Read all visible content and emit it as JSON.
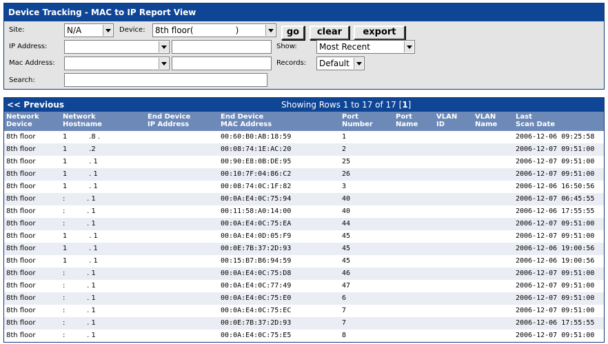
{
  "title": "Device Tracking - MAC to IP Report View",
  "filters": {
    "site_label": "Site:",
    "site_value": "N/A",
    "device_label": "Device:",
    "device_value": "8th floor(                )",
    "ip_label": "IP Address:",
    "ip_select_value": "",
    "ip_text_value": "",
    "show_label": "Show:",
    "show_value": "Most Recent",
    "mac_label": "Mac Address:",
    "mac_select_value": "",
    "mac_text_value": "",
    "records_label": "Records:",
    "records_value": "Default",
    "search_label": "Search:",
    "search_value": "",
    "go_label": "go",
    "clear_label": "clear",
    "export_label": "export"
  },
  "results": {
    "previous_label": "<< Previous",
    "showing_text": "Showing Rows 1 to 17 of 17 [",
    "page_num": "1",
    "showing_end": "]"
  },
  "columns": [
    {
      "line1": "Network",
      "line2": "Device"
    },
    {
      "line1": "Network",
      "line2": "Hostname"
    },
    {
      "line1": "End Device",
      "line2": "IP Address"
    },
    {
      "line1": "End Device",
      "line2": "MAC Address"
    },
    {
      "line1": "Port",
      "line2": "Number"
    },
    {
      "line1": "Port",
      "line2": "Name"
    },
    {
      "line1": "VLAN",
      "line2": "ID"
    },
    {
      "line1": "VLAN",
      "line2": "Name"
    },
    {
      "line1": "Last",
      "line2": "Scan Date"
    }
  ],
  "rows": [
    {
      "device": "8th floor",
      "host": "1          .8 .",
      "mac": "00:60:B0:AB:18:59",
      "port": "1",
      "date": "2006-12-06 09:25:58"
    },
    {
      "device": "8th floor",
      "host": "1          .2",
      "mac": "00:08:74:1E:AC:20",
      "port": "2",
      "date": "2006-12-07 09:51:00"
    },
    {
      "device": "8th floor",
      "host": "1          . 1",
      "mac": "00:90:E8:0B:DE:95",
      "port": "25",
      "date": "2006-12-07 09:51:00"
    },
    {
      "device": "8th floor",
      "host": "1          . 1",
      "mac": "00:10:7F:04:86:C2",
      "port": "26",
      "date": "2006-12-07 09:51:00"
    },
    {
      "device": "8th floor",
      "host": "1          . 1",
      "mac": "00:08:74:0C:1F:82",
      "port": "3",
      "date": "2006-12-06 16:50:56"
    },
    {
      "device": "8th floor",
      "host": ":          . 1",
      "mac": "00:0A:E4:0C:75:94",
      "port": "40",
      "date": "2006-12-07 06:45:55"
    },
    {
      "device": "8th floor",
      "host": ":          . 1",
      "mac": "00:11:58:A0:14:00",
      "port": "40",
      "date": "2006-12-06 17:55:55"
    },
    {
      "device": "8th floor",
      "host": ":          . 1",
      "mac": "00:0A:E4:0C:75:EA",
      "port": "44",
      "date": "2006-12-07 09:51:00"
    },
    {
      "device": "8th floor",
      "host": "1          . 1",
      "mac": "00:0A:E4:0D:05:F9",
      "port": "45",
      "date": "2006-12-07 09:51:00"
    },
    {
      "device": "8th floor",
      "host": "1          . 1",
      "mac": "00:0E:7B:37:2D:93",
      "port": "45",
      "date": "2006-12-06 19:00:56"
    },
    {
      "device": "8th floor",
      "host": "1          . 1",
      "mac": "00:15:B7:B6:94:59",
      "port": "45",
      "date": "2006-12-06 19:00:56"
    },
    {
      "device": "8th floor",
      "host": ":          . 1",
      "mac": "00:0A:E4:0C:75:D8",
      "port": "46",
      "date": "2006-12-07 09:51:00"
    },
    {
      "device": "8th floor",
      "host": ":          . 1",
      "mac": "00:0A:E4:0C:77:49",
      "port": "47",
      "date": "2006-12-07 09:51:00"
    },
    {
      "device": "8th floor",
      "host": ":          . 1",
      "mac": "00:0A:E4:0C:75:E0",
      "port": "6",
      "date": "2006-12-07 09:51:00"
    },
    {
      "device": "8th floor",
      "host": ":          . 1",
      "mac": "00:0A:E4:0C:75:EC",
      "port": "7",
      "date": "2006-12-07 09:51:00"
    },
    {
      "device": "8th floor",
      "host": ":          . 1",
      "mac": "00:0E:7B:37:2D:93",
      "port": "7",
      "date": "2006-12-06 17:55:55"
    },
    {
      "device": "8th floor",
      "host": ":          . 1",
      "mac": "00:0A:E4:0C:75:E5",
      "port": "8",
      "date": "2006-12-07 09:51:00"
    }
  ],
  "colors": {
    "header_bg": "#0f4595",
    "column_header_bg": "#6d89b8",
    "filter_bg": "#e4e4e4",
    "alt_row": "#ebedf5"
  }
}
